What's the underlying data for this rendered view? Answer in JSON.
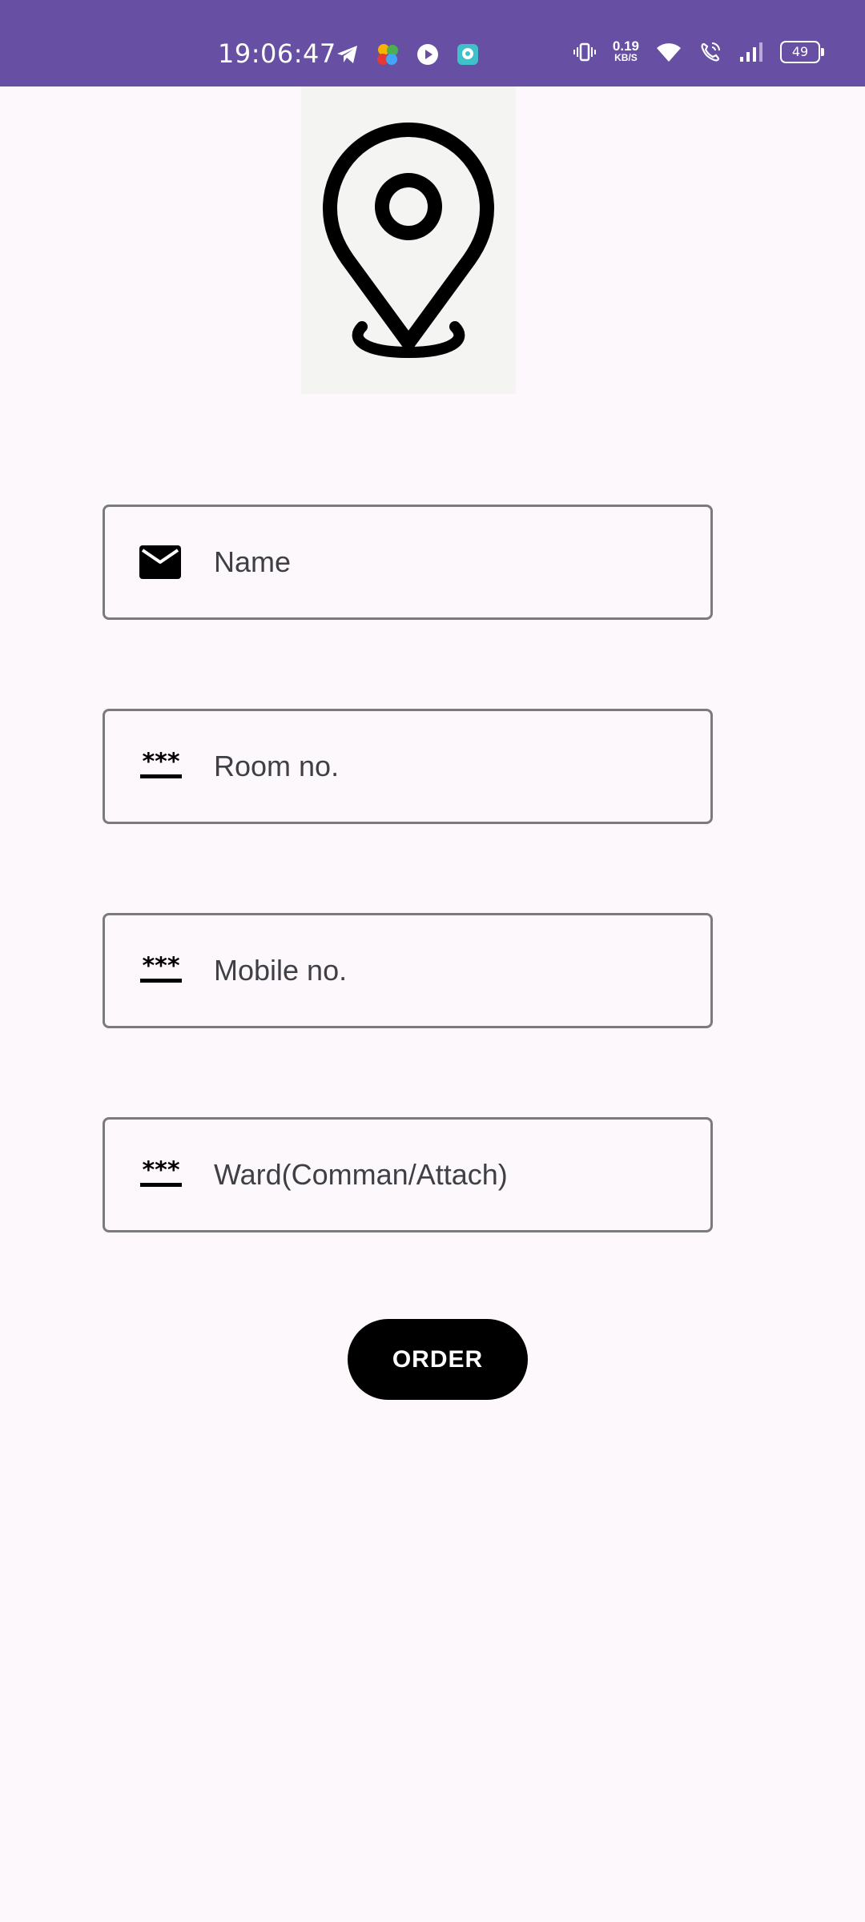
{
  "status_bar": {
    "time": "19:06:47",
    "net_speed_value": "0.19",
    "net_speed_unit": "KB/S",
    "battery_level": "49",
    "background_color": "#6750a4",
    "notification_icons": [
      "telegram-icon",
      "pinwheel-app-icon",
      "play-icon",
      "chat-app-icon"
    ],
    "system_icons": [
      "vibrate-icon",
      "wifi-icon",
      "wifi-calling-icon",
      "signal-icon",
      "battery-icon"
    ]
  },
  "logo": {
    "icon": "location-pin-icon"
  },
  "form": {
    "fields": [
      {
        "placeholder": "Name",
        "icon": "mail-icon",
        "value": ""
      },
      {
        "placeholder": "Room no.",
        "icon": "password-dots-icon",
        "value": ""
      },
      {
        "placeholder": "Mobile no.",
        "icon": "password-dots-icon",
        "value": ""
      },
      {
        "placeholder": "Ward(Comman/Attach)",
        "icon": "password-dots-icon",
        "value": ""
      }
    ],
    "submit_label": "ORDER"
  }
}
